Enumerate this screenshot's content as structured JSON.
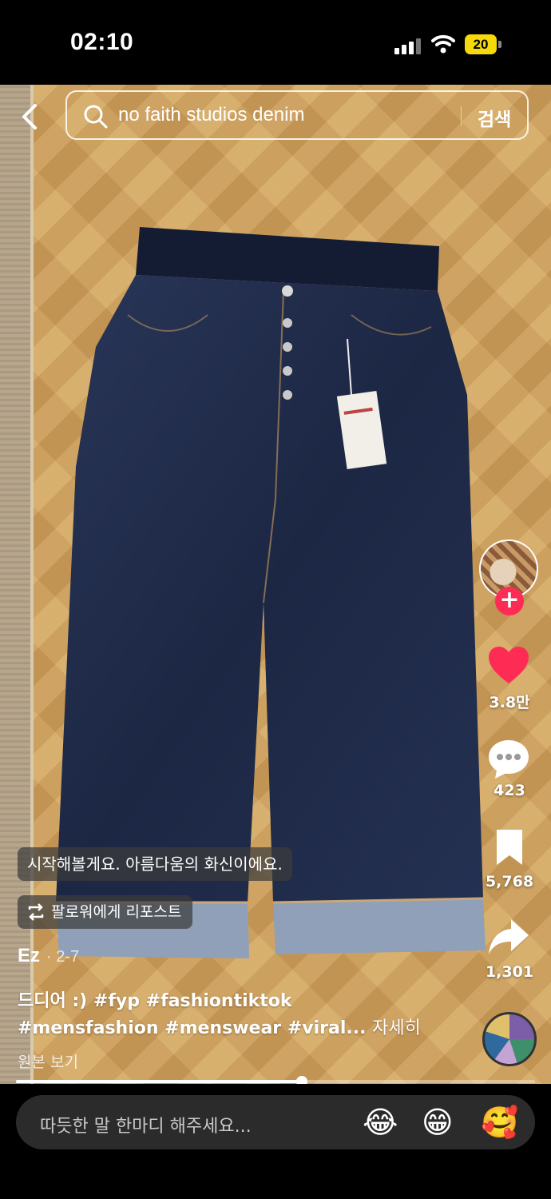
{
  "status": {
    "time": "02:10",
    "battery": "20"
  },
  "search": {
    "query": "no faith studios denim",
    "button": "검색"
  },
  "actions": {
    "likes": "3.8만",
    "comments": "423",
    "saves": "5,768",
    "shares": "1,301"
  },
  "caption_overlay": "시작해볼게요. 아름다움의 화신이에요.",
  "repost_label": "팔로워에게 리포스트",
  "post": {
    "author": "Ez",
    "date": "· 2-7",
    "description_line1": "드디어 :) #fyp #fashiontiktok",
    "description_line2": "#mensfashion #menswear #viral...",
    "more": "자세히",
    "original": "원본 보기"
  },
  "progress": 0.55,
  "comment": {
    "placeholder": "따듯한 말 한마디 해주세요...",
    "emojis": [
      "😂",
      "😁",
      "🥰"
    ]
  },
  "colors": {
    "accent": "#fe2c55",
    "like": "#fe2c55",
    "denim": "#1e2a4a",
    "floor": "#c99a5a"
  }
}
